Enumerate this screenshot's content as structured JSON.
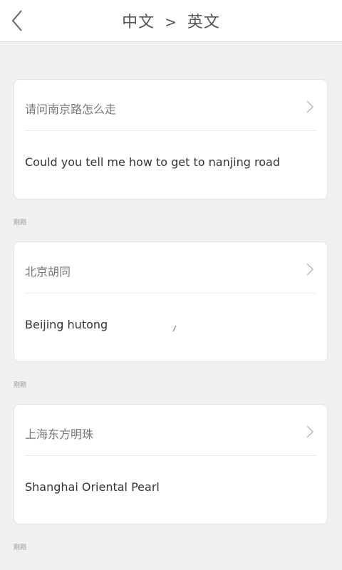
{
  "header": {
    "back_icon": "chevron-left-icon",
    "source_lang": "中文",
    "arrow": ">",
    "target_lang": "英文"
  },
  "history": [
    {
      "source": "请问南京路怎么走",
      "translation": "Could you tell me how to get to nanjing road",
      "time": "刚刚"
    },
    {
      "source": "北京胡同",
      "translation": "Beijing hutong",
      "time": "刚刚"
    },
    {
      "source": "上海东方明珠",
      "translation": "Shanghai Oriental Pearl",
      "time": "刚刚"
    }
  ],
  "colors": {
    "background": "#f0f0f0",
    "card": "#ffffff",
    "source_text": "#777777",
    "translation_text": "#333333"
  }
}
